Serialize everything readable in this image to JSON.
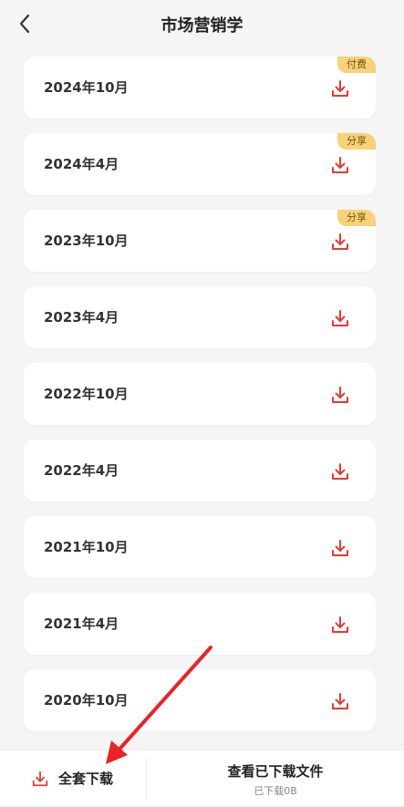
{
  "header": {
    "title": "市场营销学"
  },
  "items": [
    {
      "label": "2024年10月",
      "tag": "付费"
    },
    {
      "label": "2024年4月",
      "tag": "分享"
    },
    {
      "label": "2023年10月",
      "tag": "分享"
    },
    {
      "label": "2023年4月",
      "tag": ""
    },
    {
      "label": "2022年10月",
      "tag": ""
    },
    {
      "label": "2022年4月",
      "tag": ""
    },
    {
      "label": "2021年10月",
      "tag": ""
    },
    {
      "label": "2021年4月",
      "tag": ""
    },
    {
      "label": "2020年10月",
      "tag": ""
    }
  ],
  "bottom": {
    "download_all": "全套下载",
    "view_downloads": "查看已下载文件",
    "downloaded_size": "已下载0B"
  },
  "colors": {
    "accent": "#e53935",
    "tag_bg": "#f7d27a",
    "page_bg": "#f5f5f5",
    "arrow": "#e8232a"
  },
  "icons": {
    "back": "chevron-left-icon",
    "download": "download-icon"
  }
}
